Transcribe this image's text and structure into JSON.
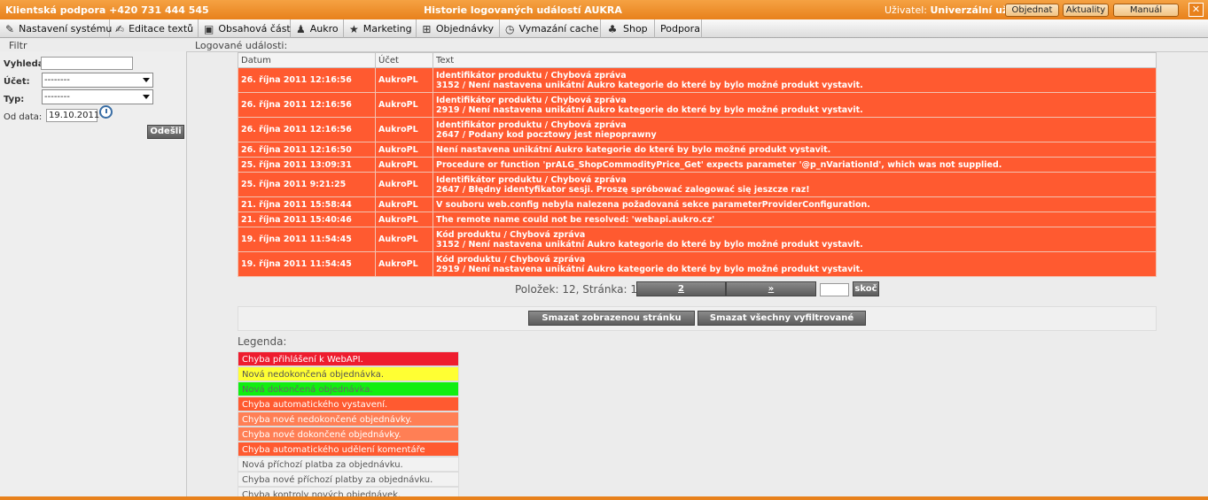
{
  "titlebar": {
    "support": "Klientská podpora +420 731 444 545",
    "title": "Historie logovaných událostí AUKRA",
    "user_label": "Uživatel:",
    "user_name": "Univerzální uživatel",
    "buttons": [
      "Objednat",
      "Aktuality",
      "Manuál"
    ],
    "close": "✕"
  },
  "menu": [
    {
      "label": "Nastavení systému",
      "icon": "wrench-icon",
      "glyph": "✎"
    },
    {
      "label": "Editace textů",
      "icon": "edit-icon",
      "glyph": "✍"
    },
    {
      "label": "Obsahová část",
      "icon": "document-icon",
      "glyph": "▣"
    },
    {
      "label": "Aukro",
      "icon": "person-icon",
      "glyph": "♟"
    },
    {
      "label": "Marketing",
      "icon": "star-icon",
      "glyph": "★"
    },
    {
      "label": "Objednávky",
      "icon": "cart-icon",
      "glyph": "⊞"
    },
    {
      "label": "Vymazání cache",
      "icon": "clock-icon",
      "glyph": "◷"
    },
    {
      "label": "Shop",
      "icon": "shop-icon",
      "glyph": "♣"
    },
    {
      "label": "Podpora",
      "icon": "",
      "glyph": ""
    }
  ],
  "filter": {
    "header": "Filtr",
    "search_label": "Vyhledat:",
    "search_value": "",
    "account_label": "Účet:",
    "account_value": "--------",
    "type_label": "Typ:",
    "type_value": "--------",
    "from_label": "Od data:",
    "from_value": "19.10.2011",
    "submit": "Odešli"
  },
  "log": {
    "header": "Logované události:",
    "columns": [
      "Datum",
      "Účet",
      "Text"
    ],
    "rows": [
      {
        "date": "26. října 2011 12:16:56",
        "account": "AukroPL",
        "line1": "Identifikátor produktu / Chybová zpráva",
        "line2": "3152 / Není nastavena unikátní Aukro kategorie do které by bylo možné produkt vystavit."
      },
      {
        "date": "26. října 2011 12:16:56",
        "account": "AukroPL",
        "line1": "Identifikátor produktu / Chybová zpráva",
        "line2": "2919 / Není nastavena unikátní Aukro kategorie do které by bylo možné produkt vystavit."
      },
      {
        "date": "26. října 2011 12:16:56",
        "account": "AukroPL",
        "line1": "Identifikátor produktu / Chybová zpráva",
        "line2": "2647 / Podany kod pocztowy jest niepoprawny"
      },
      {
        "date": "26. října 2011 12:16:50",
        "account": "AukroPL",
        "line1": "Není nastavena unikátní Aukro kategorie do které by bylo možné produkt vystavit.",
        "line2": ""
      },
      {
        "date": "25. října 2011 13:09:31",
        "account": "AukroPL",
        "line1": "Procedure or function 'prALG_ShopCommodityPrice_Get' expects parameter '@p_nVariationId', which was not supplied.",
        "line2": ""
      },
      {
        "date": "25. října 2011 9:21:25",
        "account": "AukroPL",
        "line1": "Identifikátor produktu / Chybová zpráva",
        "line2": "2647 / Błędny identyfikator sesji. Proszę spróbować zalogować się jeszcze raz!"
      },
      {
        "date": "21. října 2011 15:58:44",
        "account": "AukroPL",
        "line1": "V souboru web.config nebyla nalezena požadovaná sekce parameterProviderConfiguration.",
        "line2": ""
      },
      {
        "date": "21. října 2011 15:40:46",
        "account": "AukroPL",
        "line1": "The remote name could not be resolved: 'webapi.aukro.cz'",
        "line2": ""
      },
      {
        "date": "19. října 2011 11:54:45",
        "account": "AukroPL",
        "line1": "Kód produktu / Chybová zpráva",
        "line2": "3152 / Není nastavena unikátní Aukro kategorie do které by bylo možné produkt vystavit."
      },
      {
        "date": "19. října 2011 11:54:45",
        "account": "AukroPL",
        "line1": "Kód produktu / Chybová zpráva",
        "line2": "2919 / Není nastavena unikátní Aukro kategorie do které by bylo možné produkt vystavit."
      }
    ],
    "row_color": "#ff5a30"
  },
  "pager": {
    "summary": "Položek: 12, Stránka: 1",
    "page2": "2",
    "next": "»",
    "goto_value": "",
    "goto_button": "skoč"
  },
  "actions": {
    "delete_page": "Smazat zobrazenou stránku",
    "delete_filtered": "Smazat všechny vyfiltrované"
  },
  "legend": {
    "title": "Legenda:",
    "items": [
      {
        "label": "Chyba přihlášení k WebAPI.",
        "bg": "#ee1c2e",
        "fg": "#ffffff"
      },
      {
        "label": "Nová nedokončená objednávka.",
        "bg": "#ffff33",
        "fg": "#555555"
      },
      {
        "label": "Nová dokončená objednávka.",
        "bg": "#11ee11",
        "fg": "#666666"
      },
      {
        "label": "Chyba automatického vystavení.",
        "bg": "#ff5a30",
        "fg": "#ffffff"
      },
      {
        "label": "Chyba nové nedokončené objednávky.",
        "bg": "#ff7f55",
        "fg": "#ffffff"
      },
      {
        "label": "Chyba nové dokončené objednávky.",
        "bg": "#ff7f55",
        "fg": "#ffffff"
      },
      {
        "label": "Chyba automatického udělení komentáře kupujícímu.",
        "bg": "#ff5a30",
        "fg": "#ffffff"
      },
      {
        "label": "Nová příchozí platba za objednávku.",
        "bg": "#f2f2f2",
        "fg": "#555555"
      },
      {
        "label": "Chyba nové příchozí platby za objednávku.",
        "bg": "#f2f2f2",
        "fg": "#555555"
      },
      {
        "label": "Chyba kontroly nových objednávek.",
        "bg": "#f2f2f2",
        "fg": "#555555"
      }
    ]
  }
}
